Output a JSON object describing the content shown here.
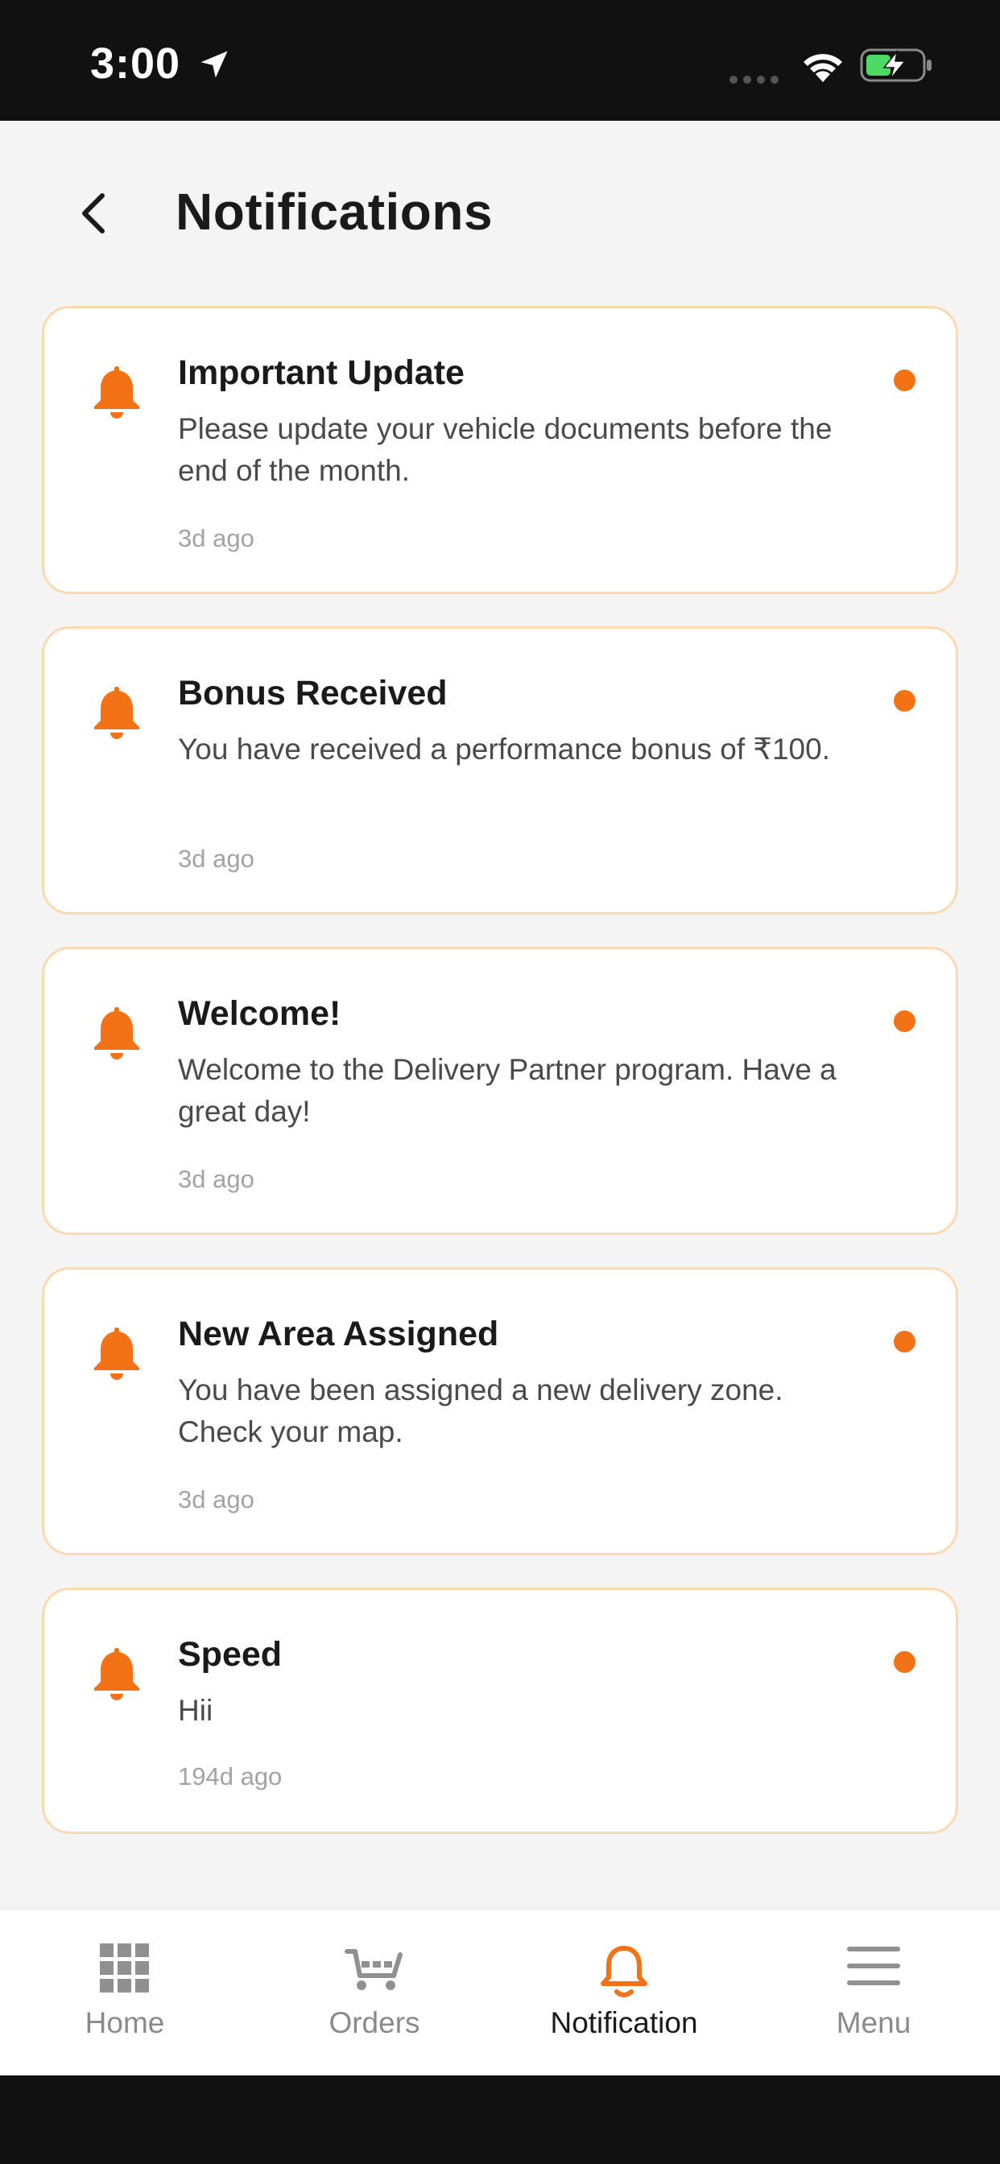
{
  "status_bar": {
    "time": "3:00"
  },
  "header": {
    "title": "Notifications"
  },
  "notifications": [
    {
      "title": "Important Update",
      "message": "Please update your vehicle documents before the end of the month.",
      "time": "3d ago",
      "unread": true
    },
    {
      "title": "Bonus Received",
      "message": "You have received a performance bonus of ₹100.",
      "time": "3d ago",
      "unread": true
    },
    {
      "title": "Welcome!",
      "message": "Welcome to the Delivery Partner program. Have a great day!",
      "time": "3d ago",
      "unread": true
    },
    {
      "title": "New Area Assigned",
      "message": "You have been assigned a new delivery zone. Check your map.",
      "time": "3d ago",
      "unread": true
    },
    {
      "title": "Speed",
      "message": "Hii",
      "time": "194d ago",
      "unread": true
    }
  ],
  "bottom_nav": {
    "items": [
      {
        "label": "Home",
        "icon": "grid-icon",
        "active": false
      },
      {
        "label": "Orders",
        "icon": "cart-icon",
        "active": false
      },
      {
        "label": "Notification",
        "icon": "bell-icon",
        "active": true
      },
      {
        "label": "Menu",
        "icon": "hamburger-menu-icon",
        "active": false
      }
    ]
  },
  "colors": {
    "accent": "#f47216",
    "card_border": "#fdd9b3",
    "background": "#f4f4f4",
    "battery_fill": "#4cd964"
  }
}
